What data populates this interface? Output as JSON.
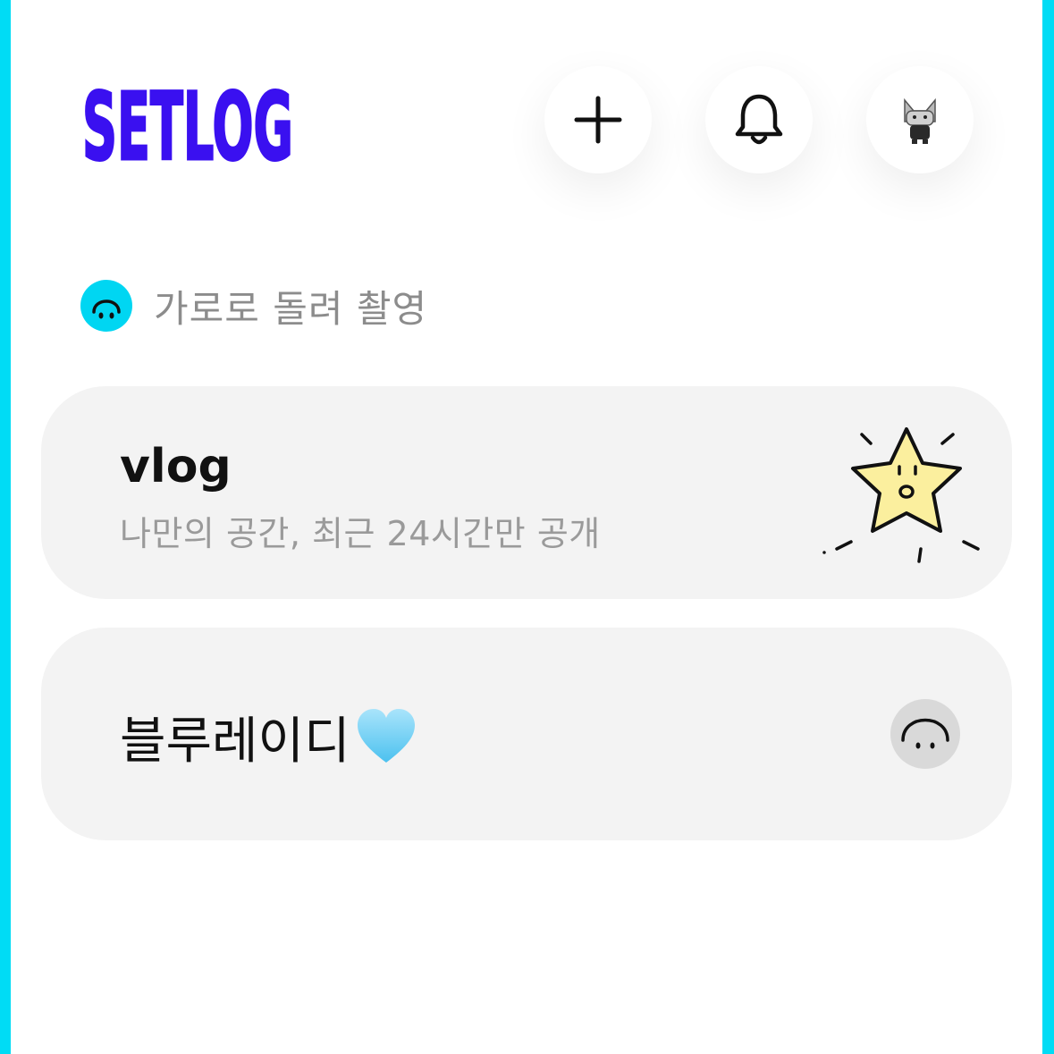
{
  "app": {
    "logo_text": "SETLOG",
    "brand_color": "#3a10f0",
    "accent_color": "#00dcf5"
  },
  "header": {
    "add_icon": "plus-icon",
    "notification_icon": "bell-icon",
    "profile_icon": "cat-avatar"
  },
  "hint": {
    "icon": "upside-down-face-icon",
    "text": "가로로 돌려 촬영"
  },
  "cards": [
    {
      "title": "vlog",
      "subtitle": "나만의 공간, 최근 24시간만 공개",
      "icon": "star-sticker-icon"
    },
    {
      "title": "블루레이디",
      "emoji_icon": "light-blue-heart-icon",
      "icon": "upside-down-face-icon"
    }
  ]
}
